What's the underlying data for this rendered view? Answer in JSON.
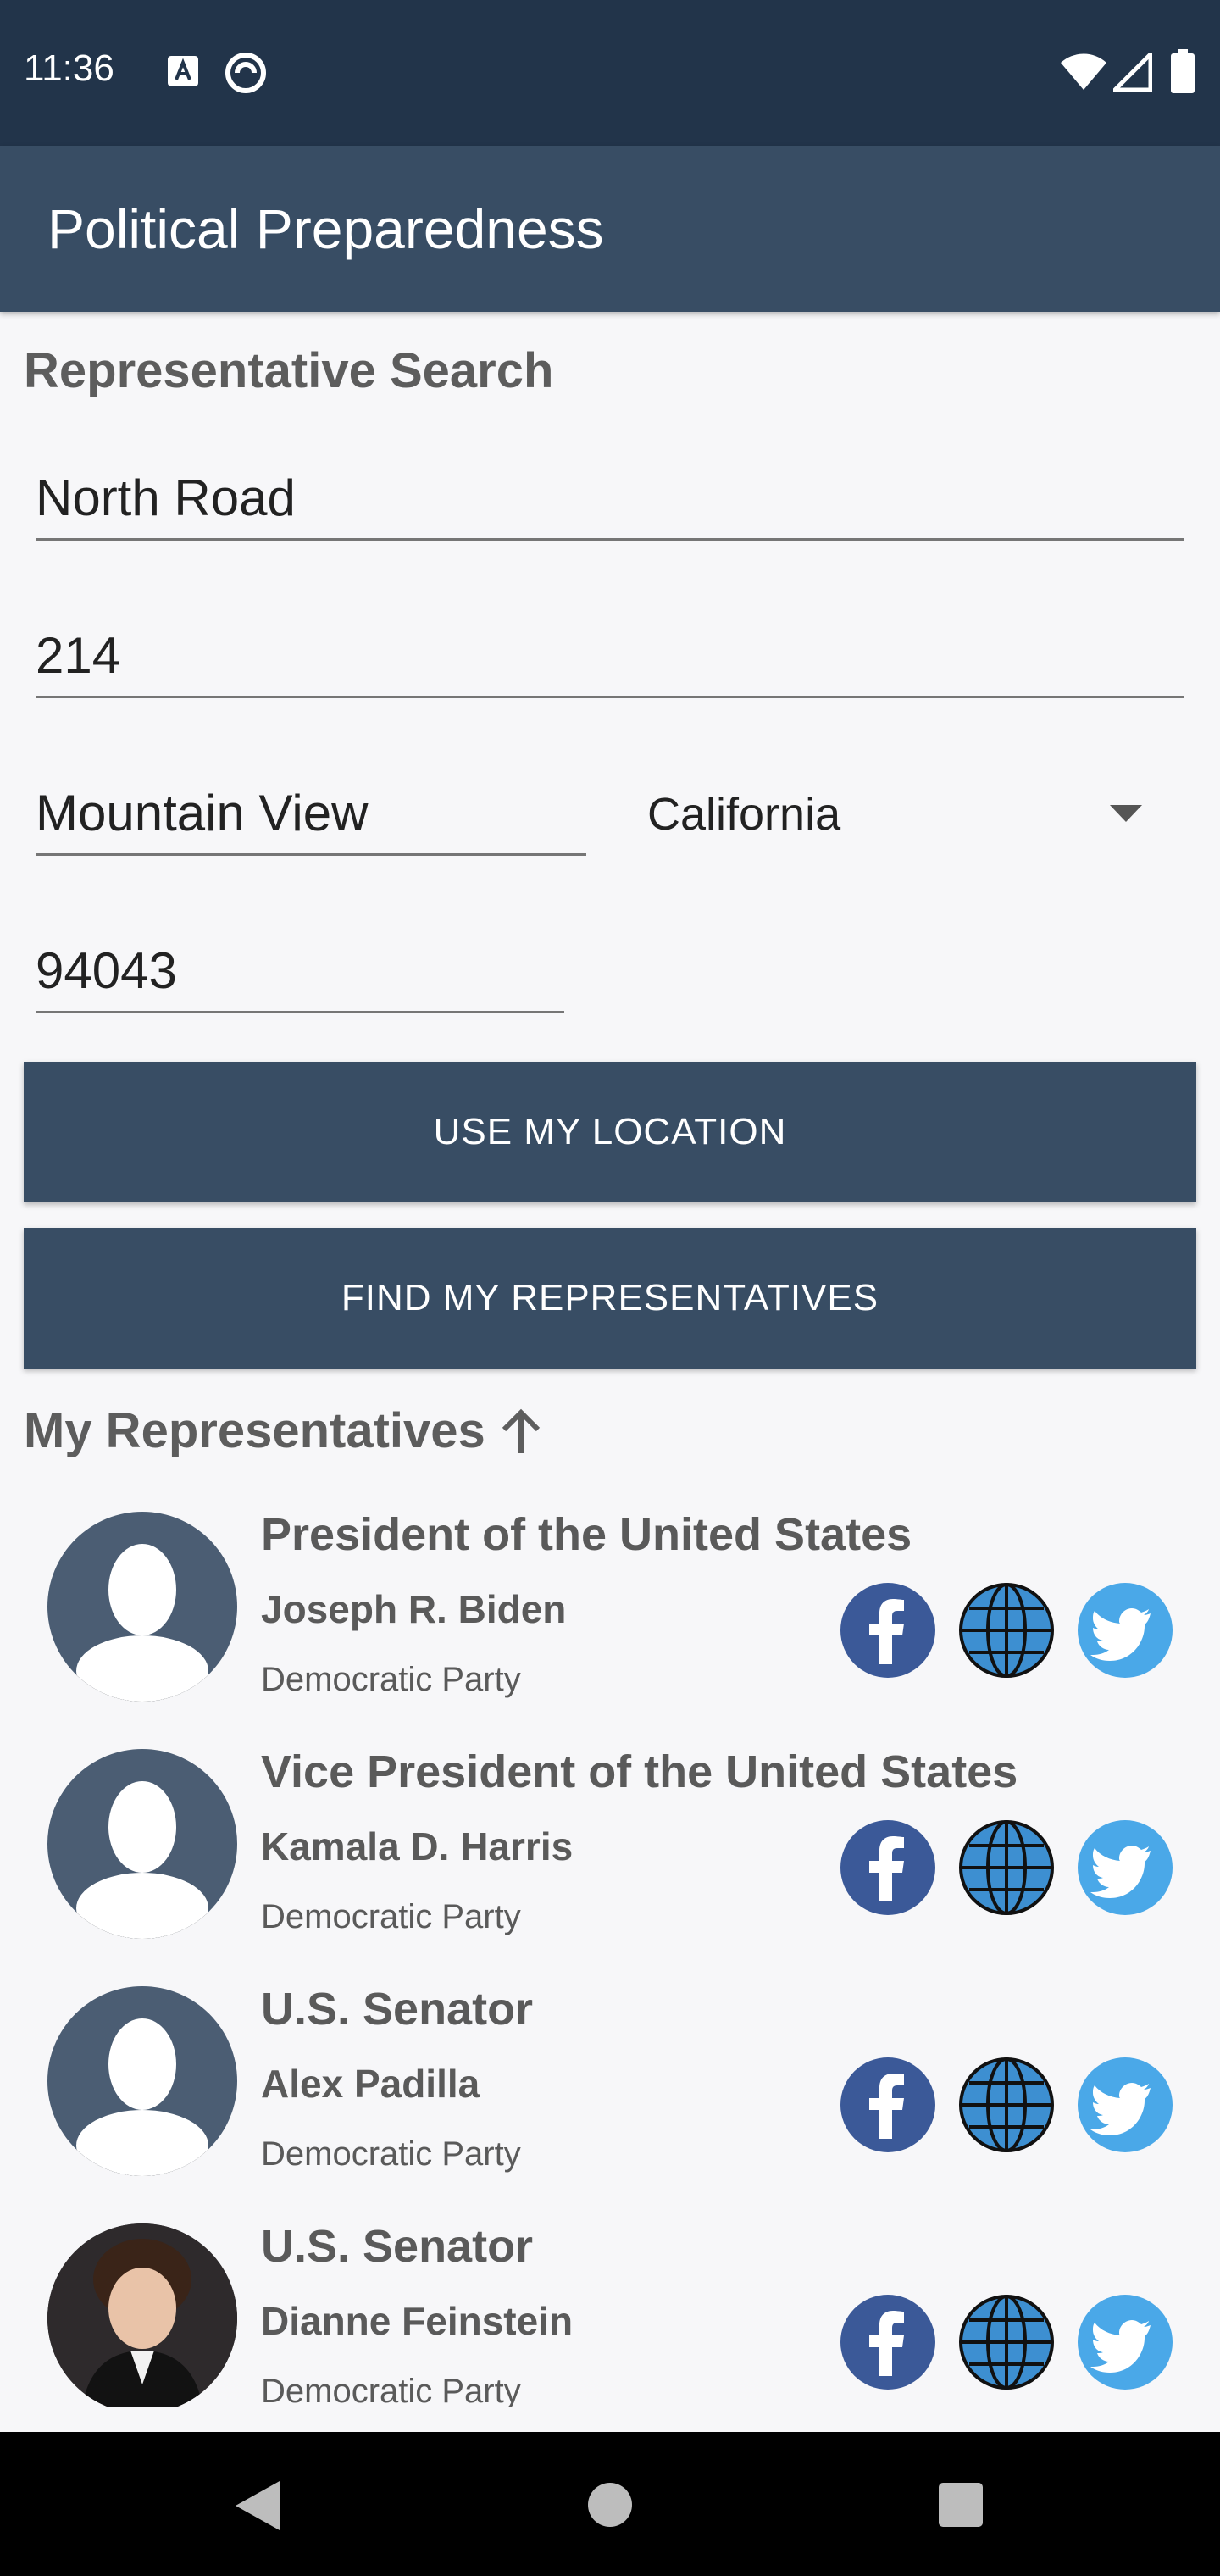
{
  "status_bar": {
    "time": "11:36"
  },
  "app_bar": {
    "title": "Political Preparedness"
  },
  "search": {
    "title": "Representative Search",
    "address_line1": "North Road",
    "address_line2": "214",
    "city": "Mountain View",
    "state": "California",
    "zip": "94043"
  },
  "buttons": {
    "use_location": "USE MY LOCATION",
    "find_representatives": "FIND MY REPRESENTATIVES"
  },
  "representatives": {
    "title": "My Representatives",
    "items": [
      {
        "office": "President of the United States",
        "name": "Joseph R. Biden",
        "party": "Democratic Party"
      },
      {
        "office": "Vice President of the United States",
        "name": "Kamala D. Harris",
        "party": "Democratic Party"
      },
      {
        "office": "U.S. Senator",
        "name": "Alex Padilla",
        "party": "Democratic Party"
      },
      {
        "office": "U.S. Senator",
        "name": "Dianne Feinstein",
        "party": "Democratic Party"
      }
    ]
  },
  "icons": {
    "facebook": "facebook-icon",
    "web": "globe-icon",
    "twitter": "twitter-icon"
  },
  "colors": {
    "status_bar": "#22344a",
    "app_bar": "#384d64",
    "button": "#384d64",
    "facebook": "#3b5998",
    "globe": "#3d8fd1",
    "twitter": "#4aa8e8"
  }
}
